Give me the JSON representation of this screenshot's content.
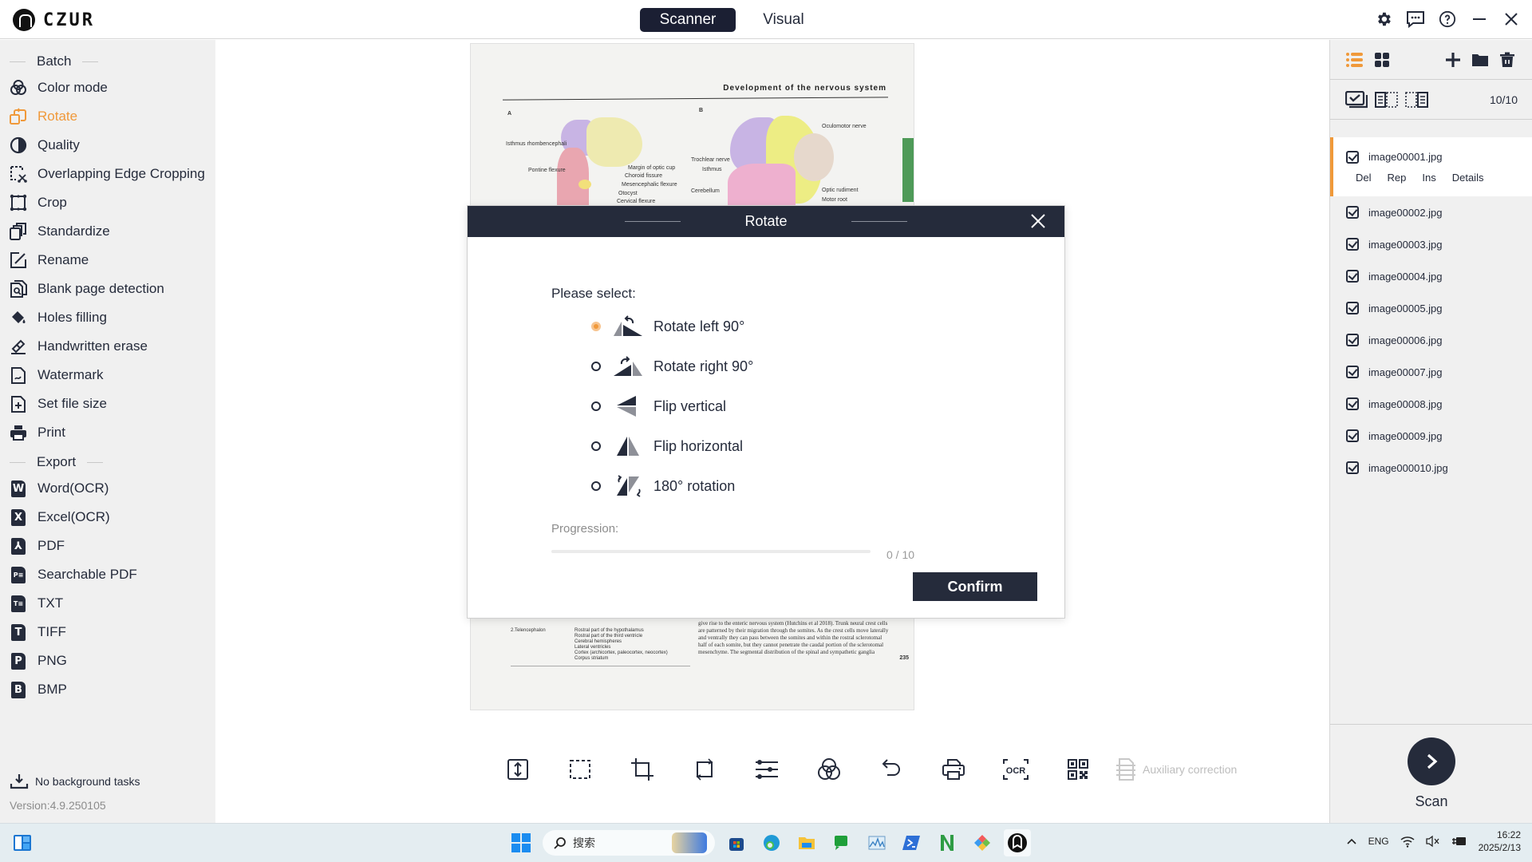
{
  "app": {
    "name": "CZUR",
    "modes": [
      {
        "label": "Scanner",
        "active": true
      },
      {
        "label": "Visual",
        "active": false
      }
    ],
    "window_controls": [
      "settings-icon",
      "feedback-icon",
      "help-icon",
      "minimize-icon",
      "close-icon"
    ]
  },
  "sidebar": {
    "batch_header": "Batch",
    "batch_items": [
      {
        "label": "Color mode",
        "icon": "color-mode-icon"
      },
      {
        "label": "Rotate",
        "icon": "rotate-icon",
        "active": true
      },
      {
        "label": "Quality",
        "icon": "quality-icon"
      },
      {
        "label": "Overlapping Edge Cropping",
        "icon": "edge-crop-icon"
      },
      {
        "label": "Crop",
        "icon": "crop-icon"
      },
      {
        "label": "Standardize",
        "icon": "standardize-icon"
      },
      {
        "label": "Rename",
        "icon": "rename-icon"
      },
      {
        "label": "Blank page detection",
        "icon": "blank-page-icon"
      },
      {
        "label": "Holes filling",
        "icon": "holes-filling-icon"
      },
      {
        "label": "Handwritten erase",
        "icon": "eraser-icon"
      },
      {
        "label": "Watermark",
        "icon": "watermark-icon"
      },
      {
        "label": "Set file size",
        "icon": "file-size-icon"
      },
      {
        "label": "Print",
        "icon": "print-icon"
      }
    ],
    "export_header": "Export",
    "export_items": [
      {
        "label": "Word(OCR)",
        "glyph": "W"
      },
      {
        "label": "Excel(OCR)",
        "glyph": "X"
      },
      {
        "label": "PDF",
        "glyph": "⅄"
      },
      {
        "label": "Searchable PDF",
        "glyph": "P≡"
      },
      {
        "label": "TXT",
        "glyph": "T≡"
      },
      {
        "label": "TIFF",
        "glyph": "T"
      },
      {
        "label": "PNG",
        "glyph": "P"
      },
      {
        "label": "BMP",
        "glyph": "B"
      }
    ],
    "background_tasks": "No background tasks",
    "version": "Version:4.9.250105"
  },
  "preview": {
    "heading": "Development of the nervous system",
    "panel_a": "A",
    "panel_b": "B",
    "labels_a": [
      "Isthmus rhombencephali",
      "Pontine flexure",
      "Margin of optic cup",
      "Choroid fissure",
      "Mesencephalic flexure",
      "Otocyst",
      "Cervical flexure"
    ],
    "labels_b": [
      "Oculomotor nerve",
      "Trochlear nerve",
      "Isthmus",
      "Cerebellum",
      "Optic rudiment",
      "Motor root"
    ],
    "table_left": "2.Telencephalon",
    "table_right": [
      "Rostral part of the hypothalamus",
      "Rostral part of the third ventricle",
      "Cerebral hemispheres",
      "Lateral ventricles",
      "Cortex (archicortex, paleocortex, neocortex)",
      "Corpus striatum"
    ],
    "body_text": "give rise to the enteric nervous system (Hutchins et al 2018). Trunk neural crest cells are patterned by their migration through the somites. As the crest cells move laterally and ventrally they can pass between the somites and within the rostral sclerotomal half of each somite, but they cannot penetrate the caudal portion of the sclerotomal mesenchyme. The segmental distribution of the spinal and sympathetic ganglia",
    "page_number": "235"
  },
  "toolbar": {
    "buttons": [
      "fit-height-icon",
      "select-area-icon",
      "crop-icon",
      "rotate-icon",
      "adjust-icon",
      "color-mode-icon",
      "undo-icon",
      "print-icon",
      "ocr-icon",
      "qr-code-icon"
    ],
    "ocr_label": "OCR",
    "auxiliary_label": "Auxiliary correction"
  },
  "right_panel": {
    "count": "10/10",
    "files": [
      {
        "name": "image00001.jpg",
        "checked": true,
        "selected": true
      },
      {
        "name": "image00002.jpg",
        "checked": true
      },
      {
        "name": "image00003.jpg",
        "checked": true
      },
      {
        "name": "image00004.jpg",
        "checked": true
      },
      {
        "name": "image00005.jpg",
        "checked": true
      },
      {
        "name": "image00006.jpg",
        "checked": true
      },
      {
        "name": "image00007.jpg",
        "checked": true
      },
      {
        "name": "image00008.jpg",
        "checked": true
      },
      {
        "name": "image00009.jpg",
        "checked": true
      },
      {
        "name": "image000010.jpg",
        "checked": true
      }
    ],
    "file_actions": [
      "Del",
      "Rep",
      "Ins",
      "Details"
    ],
    "scan_label": "Scan"
  },
  "dialog": {
    "title": "Rotate",
    "prompt": "Please select:",
    "options": [
      {
        "label": "Rotate left 90°",
        "selected": true
      },
      {
        "label": "Rotate right 90°",
        "selected": false
      },
      {
        "label": "Flip vertical",
        "selected": false
      },
      {
        "label": "Flip horizontal",
        "selected": false
      },
      {
        "label": "180° rotation",
        "selected": false
      }
    ],
    "progress_label": "Progression:",
    "progress_done": 0,
    "progress_total": 10,
    "progress_text": "0 / 10",
    "confirm_label": "Confirm"
  },
  "taskbar": {
    "search_placeholder": "搜索",
    "language": "ENG",
    "time": "16:22",
    "date": "2025/2/13"
  },
  "colors": {
    "accent": "#f0993a",
    "dark": "#252b3b",
    "sidebar_bg": "#f0f0f0"
  }
}
